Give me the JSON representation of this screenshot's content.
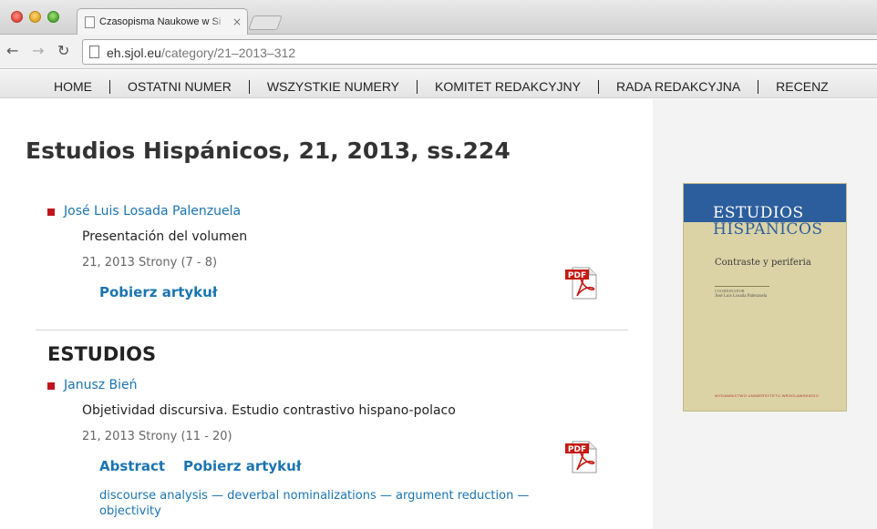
{
  "browser": {
    "tab_title": "Czasopisma Naukowe w Si",
    "tab_close": "×",
    "url_host": "eh.sjol.eu",
    "url_path": "/category/21–2013–312",
    "back_glyph": "←",
    "forward_glyph": "→",
    "reload_glyph": "↻"
  },
  "site_nav": {
    "items": [
      "HOME",
      "OSTATNI NUMER",
      "WSZYSTKIE NUMERY",
      "KOMITET REDAKCYJNY",
      "RADA REDAKCYJNA",
      "RECENZ"
    ]
  },
  "page": {
    "title": "Estudios Hispánicos, 21, 2013, ss.224"
  },
  "articles": [
    {
      "author": "José Luis Losada Palenzuela",
      "title": "Presentación del volumen",
      "meta": "21, 2013 Strony (7 - 8)",
      "download_label": "Pobierz artykuł"
    },
    {
      "author": "Janusz Bień",
      "title": "Objetividad discursiva. Estudio contrastivo hispano-polaco",
      "meta": "21, 2013 Strony (11 - 20)",
      "abstract_label": "Abstract",
      "download_label": "Pobierz artykuł",
      "keywords": "discourse analysis — deverbal nominalizations — argument reduction — objectivity"
    }
  ],
  "section": {
    "heading": "ESTUDIOS"
  },
  "cover": {
    "title_line1": "ESTUDIOS",
    "title_line2": "HISPÁNICOS",
    "subtitle": "Contraste y periferia",
    "editor_label": "COORDINADOR",
    "editor": "José Luis Losada Palenzuela",
    "publisher": "WYDAWNICTWO UNIWERSYTETU WROCŁAWSKIEGO"
  },
  "pdf_icon_label": "PDF",
  "colors": {
    "link": "#1a74b0",
    "bullet": "#c0151c",
    "cover_blue": "#2c5e9e",
    "cover_bg": "#dbd3a6"
  }
}
